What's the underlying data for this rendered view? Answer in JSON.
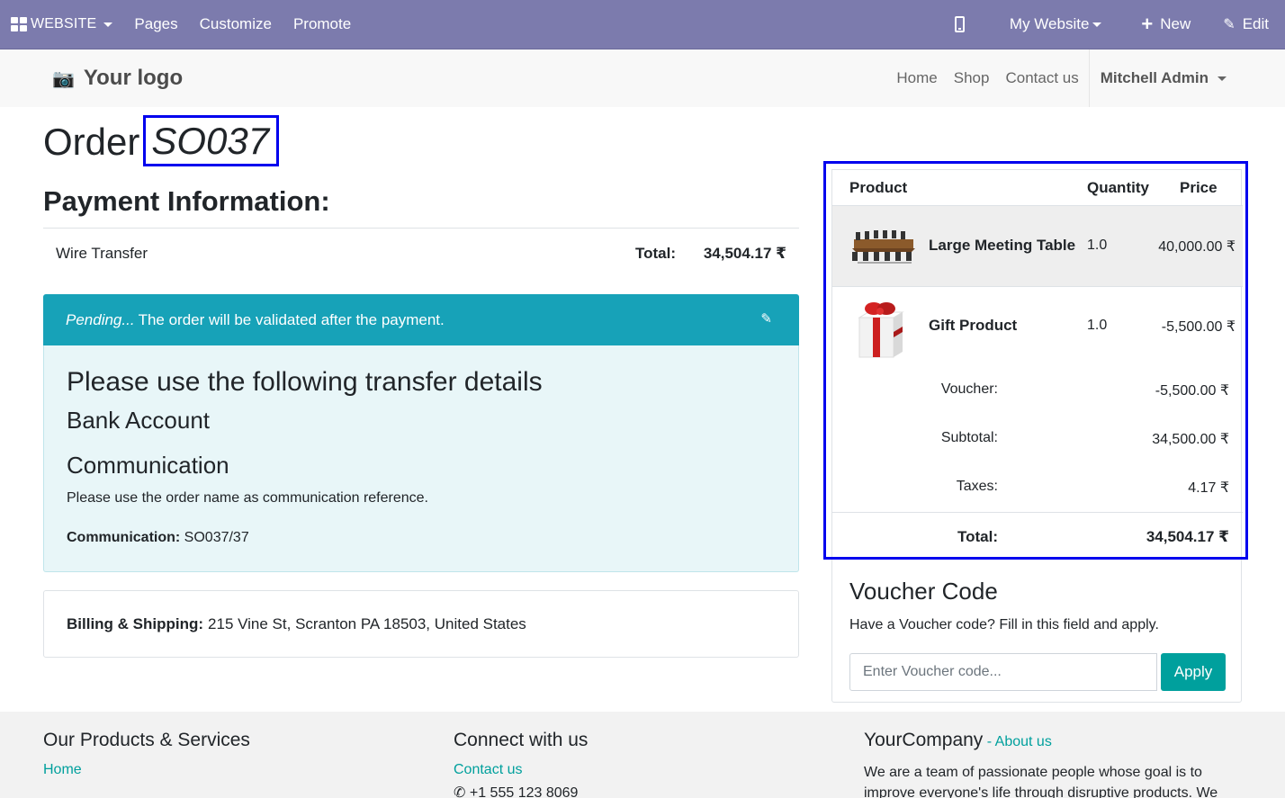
{
  "topbar": {
    "brand": "WEBSITE",
    "menu": [
      "Pages",
      "Customize",
      "Promote"
    ],
    "website": "My Website",
    "new_label": "New",
    "edit_label": "Edit"
  },
  "header": {
    "logo_text": "Your logo",
    "nav": [
      "Home",
      "Shop",
      "Contact us"
    ],
    "user": "Mitchell Admin"
  },
  "order": {
    "title_prefix": "Order",
    "number": "SO037"
  },
  "payment": {
    "heading": "Payment Information:",
    "method": "Wire Transfer",
    "total_label": "Total:",
    "total_value": "34,504.17 ₹"
  },
  "alert": {
    "status": "Pending...",
    "message": "The order will be validated after the payment.",
    "h1": "Please use the following transfer details",
    "h2": "Bank Account",
    "h3": "Communication",
    "instruction": "Please use the order name as communication reference.",
    "communication_label": "Communication:",
    "communication_value": "SO037/37"
  },
  "billing": {
    "label": "Billing & Shipping:",
    "address": "215 Vine St, Scranton PA 18503, United States"
  },
  "summary": {
    "headers": {
      "product": "Product",
      "quantity": "Quantity",
      "price": "Price"
    },
    "lines": [
      {
        "name": "Large Meeting Table",
        "qty": "1.0",
        "price": "40,000.00 ₹"
      },
      {
        "name": "Gift Product",
        "qty": "1.0",
        "price": "-5,500.00 ₹"
      }
    ],
    "voucher_label": "Voucher:",
    "voucher_value": "-5,500.00 ₹",
    "subtotal_label": "Subtotal:",
    "subtotal_value": "34,500.00 ₹",
    "taxes_label": "Taxes:",
    "taxes_value": "4.17 ₹",
    "total_label": "Total:",
    "total_value": "34,504.17 ₹"
  },
  "voucher": {
    "title": "Voucher Code",
    "desc": "Have a Voucher code? Fill in this field and apply.",
    "placeholder": "Enter Voucher code...",
    "apply": "Apply"
  },
  "footer": {
    "col1_title": "Our Products & Services",
    "col1_link": "Home",
    "col2_title": "Connect with us",
    "col2_link": "Contact us",
    "col2_phone": "+1 555 123 8069",
    "col3_title": "YourCompany",
    "col3_sep": " - ",
    "col3_link": "About us",
    "col3_text": "We are a team of passionate people whose goal is to improve everyone's life through disruptive products. We"
  },
  "colors": {
    "admin_bar": "#7C7BAD",
    "alert_header": "#17A2B8",
    "alert_body": "#E8F6F8",
    "primary": "#00A09D",
    "highlight": "#0000EE"
  }
}
